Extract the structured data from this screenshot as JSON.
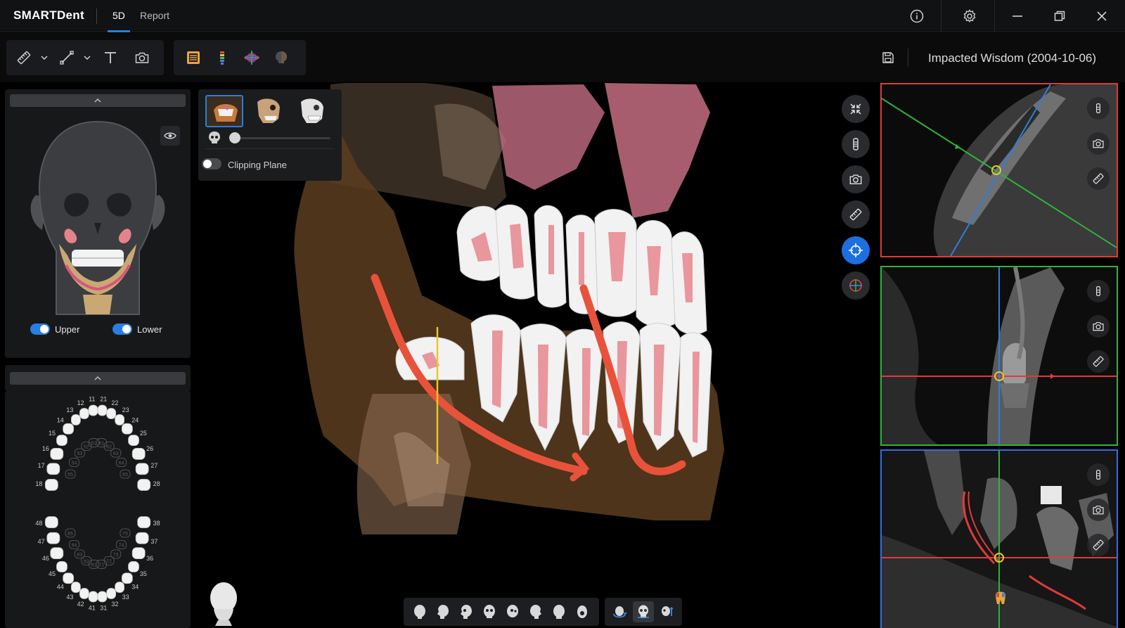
{
  "app": {
    "brand": "SMARTDent"
  },
  "tabs": [
    {
      "label": "5D",
      "active": true
    },
    {
      "label": "Report",
      "active": false
    }
  ],
  "window_controls": {
    "icons": [
      "info-icon",
      "gear-icon",
      "minimize-icon",
      "restore-icon",
      "close-icon"
    ]
  },
  "toolbar": {
    "group1_icons": [
      "ruler-icon",
      "chevron-down-icon",
      "line-measure-icon",
      "chevron-down-icon",
      "text-icon",
      "camera-icon"
    ],
    "group2_icons": [
      "panorama-icon",
      "implant-icon",
      "nerve-icon",
      "skull-color-icon"
    ]
  },
  "patient": {
    "title": "Impacted Wisdom (2004-10-06)"
  },
  "skull_panel": {
    "upper_label": "Upper",
    "lower_label": "Lower",
    "upper_on": true,
    "lower_on": true
  },
  "tooth_chart": {
    "upper_labels": [
      "11",
      "12",
      "13",
      "14",
      "15",
      "16",
      "17",
      "18",
      "21",
      "22",
      "23",
      "24",
      "25",
      "26",
      "27",
      "28"
    ],
    "lower_labels": [
      "31",
      "32",
      "33",
      "34",
      "35",
      "36",
      "37",
      "38",
      "41",
      "42",
      "43",
      "44",
      "45",
      "46",
      "47",
      "48"
    ],
    "primary_labels": [
      "51",
      "52",
      "53",
      "54",
      "55",
      "61",
      "62",
      "63",
      "64",
      "65",
      "71",
      "72",
      "73",
      "74",
      "75",
      "81",
      "82",
      "83",
      "84",
      "85"
    ]
  },
  "view_panel": {
    "clipping_label": "Clipping Plane",
    "clipping_on": false,
    "opacity_fraction": 0.0
  },
  "side_tools": [
    "shrink-icon",
    "implant-icon",
    "camera-icon",
    "ruler-icon",
    "crosshair-icon",
    "axis-icon"
  ],
  "colors": {
    "accent": "#2a7de1",
    "axial_frame": "#e03a3a",
    "sagittal_frame": "#2fb33a",
    "coronal_frame": "#2f6fe0",
    "nerve": "#e8523a"
  }
}
